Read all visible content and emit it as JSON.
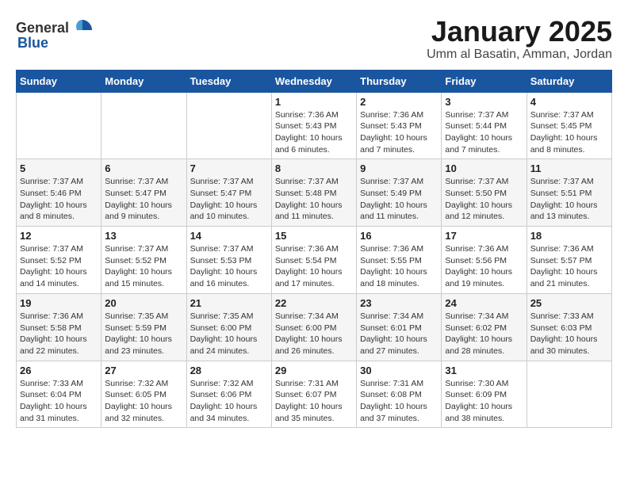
{
  "header": {
    "logo_general": "General",
    "logo_blue": "Blue",
    "month_title": "January 2025",
    "location": "Umm al Basatin, Amman, Jordan"
  },
  "weekdays": [
    "Sunday",
    "Monday",
    "Tuesday",
    "Wednesday",
    "Thursday",
    "Friday",
    "Saturday"
  ],
  "weeks": [
    [
      {
        "day": "",
        "info": ""
      },
      {
        "day": "",
        "info": ""
      },
      {
        "day": "",
        "info": ""
      },
      {
        "day": "1",
        "info": "Sunrise: 7:36 AM\nSunset: 5:43 PM\nDaylight: 10 hours\nand 6 minutes."
      },
      {
        "day": "2",
        "info": "Sunrise: 7:36 AM\nSunset: 5:43 PM\nDaylight: 10 hours\nand 7 minutes."
      },
      {
        "day": "3",
        "info": "Sunrise: 7:37 AM\nSunset: 5:44 PM\nDaylight: 10 hours\nand 7 minutes."
      },
      {
        "day": "4",
        "info": "Sunrise: 7:37 AM\nSunset: 5:45 PM\nDaylight: 10 hours\nand 8 minutes."
      }
    ],
    [
      {
        "day": "5",
        "info": "Sunrise: 7:37 AM\nSunset: 5:46 PM\nDaylight: 10 hours\nand 8 minutes."
      },
      {
        "day": "6",
        "info": "Sunrise: 7:37 AM\nSunset: 5:47 PM\nDaylight: 10 hours\nand 9 minutes."
      },
      {
        "day": "7",
        "info": "Sunrise: 7:37 AM\nSunset: 5:47 PM\nDaylight: 10 hours\nand 10 minutes."
      },
      {
        "day": "8",
        "info": "Sunrise: 7:37 AM\nSunset: 5:48 PM\nDaylight: 10 hours\nand 11 minutes."
      },
      {
        "day": "9",
        "info": "Sunrise: 7:37 AM\nSunset: 5:49 PM\nDaylight: 10 hours\nand 11 minutes."
      },
      {
        "day": "10",
        "info": "Sunrise: 7:37 AM\nSunset: 5:50 PM\nDaylight: 10 hours\nand 12 minutes."
      },
      {
        "day": "11",
        "info": "Sunrise: 7:37 AM\nSunset: 5:51 PM\nDaylight: 10 hours\nand 13 minutes."
      }
    ],
    [
      {
        "day": "12",
        "info": "Sunrise: 7:37 AM\nSunset: 5:52 PM\nDaylight: 10 hours\nand 14 minutes."
      },
      {
        "day": "13",
        "info": "Sunrise: 7:37 AM\nSunset: 5:52 PM\nDaylight: 10 hours\nand 15 minutes."
      },
      {
        "day": "14",
        "info": "Sunrise: 7:37 AM\nSunset: 5:53 PM\nDaylight: 10 hours\nand 16 minutes."
      },
      {
        "day": "15",
        "info": "Sunrise: 7:36 AM\nSunset: 5:54 PM\nDaylight: 10 hours\nand 17 minutes."
      },
      {
        "day": "16",
        "info": "Sunrise: 7:36 AM\nSunset: 5:55 PM\nDaylight: 10 hours\nand 18 minutes."
      },
      {
        "day": "17",
        "info": "Sunrise: 7:36 AM\nSunset: 5:56 PM\nDaylight: 10 hours\nand 19 minutes."
      },
      {
        "day": "18",
        "info": "Sunrise: 7:36 AM\nSunset: 5:57 PM\nDaylight: 10 hours\nand 21 minutes."
      }
    ],
    [
      {
        "day": "19",
        "info": "Sunrise: 7:36 AM\nSunset: 5:58 PM\nDaylight: 10 hours\nand 22 minutes."
      },
      {
        "day": "20",
        "info": "Sunrise: 7:35 AM\nSunset: 5:59 PM\nDaylight: 10 hours\nand 23 minutes."
      },
      {
        "day": "21",
        "info": "Sunrise: 7:35 AM\nSunset: 6:00 PM\nDaylight: 10 hours\nand 24 minutes."
      },
      {
        "day": "22",
        "info": "Sunrise: 7:34 AM\nSunset: 6:00 PM\nDaylight: 10 hours\nand 26 minutes."
      },
      {
        "day": "23",
        "info": "Sunrise: 7:34 AM\nSunset: 6:01 PM\nDaylight: 10 hours\nand 27 minutes."
      },
      {
        "day": "24",
        "info": "Sunrise: 7:34 AM\nSunset: 6:02 PM\nDaylight: 10 hours\nand 28 minutes."
      },
      {
        "day": "25",
        "info": "Sunrise: 7:33 AM\nSunset: 6:03 PM\nDaylight: 10 hours\nand 30 minutes."
      }
    ],
    [
      {
        "day": "26",
        "info": "Sunrise: 7:33 AM\nSunset: 6:04 PM\nDaylight: 10 hours\nand 31 minutes."
      },
      {
        "day": "27",
        "info": "Sunrise: 7:32 AM\nSunset: 6:05 PM\nDaylight: 10 hours\nand 32 minutes."
      },
      {
        "day": "28",
        "info": "Sunrise: 7:32 AM\nSunset: 6:06 PM\nDaylight: 10 hours\nand 34 minutes."
      },
      {
        "day": "29",
        "info": "Sunrise: 7:31 AM\nSunset: 6:07 PM\nDaylight: 10 hours\nand 35 minutes."
      },
      {
        "day": "30",
        "info": "Sunrise: 7:31 AM\nSunset: 6:08 PM\nDaylight: 10 hours\nand 37 minutes."
      },
      {
        "day": "31",
        "info": "Sunrise: 7:30 AM\nSunset: 6:09 PM\nDaylight: 10 hours\nand 38 minutes."
      },
      {
        "day": "",
        "info": ""
      }
    ]
  ]
}
